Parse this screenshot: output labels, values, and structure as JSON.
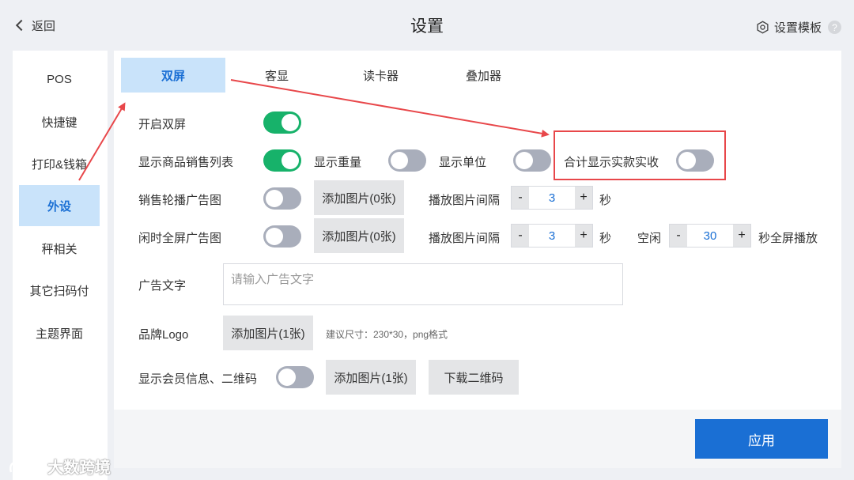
{
  "header": {
    "back_label": "返回",
    "title": "设置",
    "template_label": "设置模板",
    "help_glyph": "?"
  },
  "sidebar": {
    "items": [
      {
        "label": "POS"
      },
      {
        "label": "快捷键"
      },
      {
        "label": "打印&钱箱"
      },
      {
        "label": "外设",
        "active": true
      },
      {
        "label": "秤相关"
      },
      {
        "label": "其它扫码付"
      },
      {
        "label": "主题界面"
      }
    ]
  },
  "tabs": [
    {
      "label": "双屏",
      "active": true
    },
    {
      "label": "客显"
    },
    {
      "label": "读卡器"
    },
    {
      "label": "叠加器"
    }
  ],
  "settings": {
    "enable_dual_label": "开启双屏",
    "enable_dual_on": true,
    "show_sales_list_label": "显示商品销售列表",
    "show_sales_list_on": true,
    "show_weight_label": "显示重量",
    "show_weight_on": false,
    "show_unit_label": "显示单位",
    "show_unit_on": false,
    "show_total_paid_label": "合计显示实款实收",
    "show_total_paid_on": false,
    "sales_carousel_label": "销售轮播广告图",
    "sales_carousel_on": false,
    "sales_add_image": "添加图片(0张)",
    "sales_interval_label": "播放图片间隔",
    "sales_interval_value": "3",
    "sales_interval_unit": "秒",
    "idle_fullscreen_label": "闲时全屏广告图",
    "idle_fullscreen_on": false,
    "idle_add_image": "添加图片(0张)",
    "idle_interval_label": "播放图片间隔",
    "idle_interval_value": "3",
    "idle_interval_unit": "秒",
    "idle_label": "空闲",
    "idle_value": "30",
    "idle_after_label": "秒全屏播放",
    "ad_text_label": "广告文字",
    "ad_text_placeholder": "请输入广告文字",
    "brand_logo_label": "品牌Logo",
    "brand_add_image": "添加图片(1张)",
    "brand_hint": "建议尺寸：230*30，png格式",
    "member_qr_label": "显示会员信息、二维码",
    "member_qr_on": false,
    "member_add_image": "添加图片(1张)",
    "download_qr": "下载二维码",
    "stepper_minus": "-",
    "stepper_plus": "+"
  },
  "footer": {
    "apply_label": "应用"
  },
  "watermark": {
    "text": "大数跨境"
  },
  "colors": {
    "accent": "#1a6fd4",
    "toggle_on": "#17b26a",
    "toggle_off": "#a9aebb",
    "annotation": "#e8474a",
    "active_tab_bg": "#c9e3fa"
  }
}
